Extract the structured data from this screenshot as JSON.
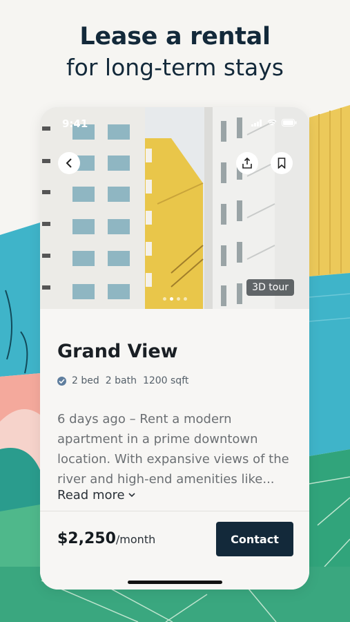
{
  "headline": {
    "line1": "Lease a rental",
    "line2": "for long-term stays"
  },
  "status_bar": {
    "time": "9:41"
  },
  "photo": {
    "tour_badge": "3D tour",
    "pager": {
      "count": 4,
      "active_index": 1
    },
    "icons": [
      "back-icon",
      "share-icon",
      "bookmark-icon"
    ]
  },
  "listing": {
    "title": "Grand View",
    "specs": {
      "beds": "2 bed",
      "baths": "2 bath",
      "area": "1200 sqft"
    },
    "description": "6 days ago – Rent a modern apartment in a prime downtown location. With expansive views of the river and high-end amenities like...",
    "read_more": "Read more"
  },
  "footer": {
    "price": "$2,250",
    "unit": "/month",
    "contact_label": "Contact"
  },
  "colors": {
    "navy": "#13293a",
    "teal": "#3bb0c6",
    "yellow": "#e9c85a",
    "green": "#2f9e78",
    "coral": "#f2a79a"
  }
}
